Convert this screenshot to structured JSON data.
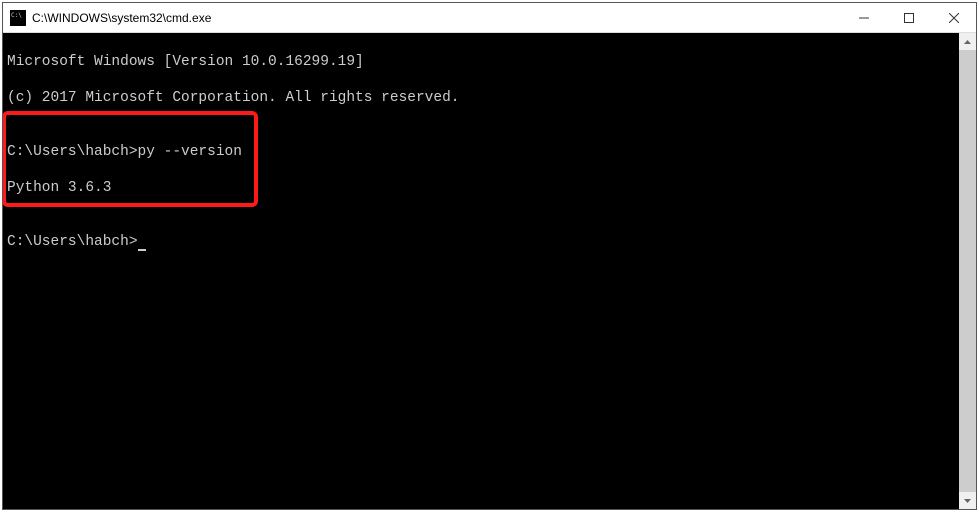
{
  "window": {
    "title": "C:\\WINDOWS\\system32\\cmd.exe"
  },
  "terminal": {
    "lines": [
      "Microsoft Windows [Version 10.0.16299.19]",
      "(c) 2017 Microsoft Corporation. All rights reserved.",
      "",
      "C:\\Users\\habch>py --version",
      "Python 3.6.3",
      "",
      "C:\\Users\\habch>"
    ],
    "prompt_last": "C:\\Users\\habch>",
    "command": "py --version",
    "output": "Python 3.6.3"
  }
}
